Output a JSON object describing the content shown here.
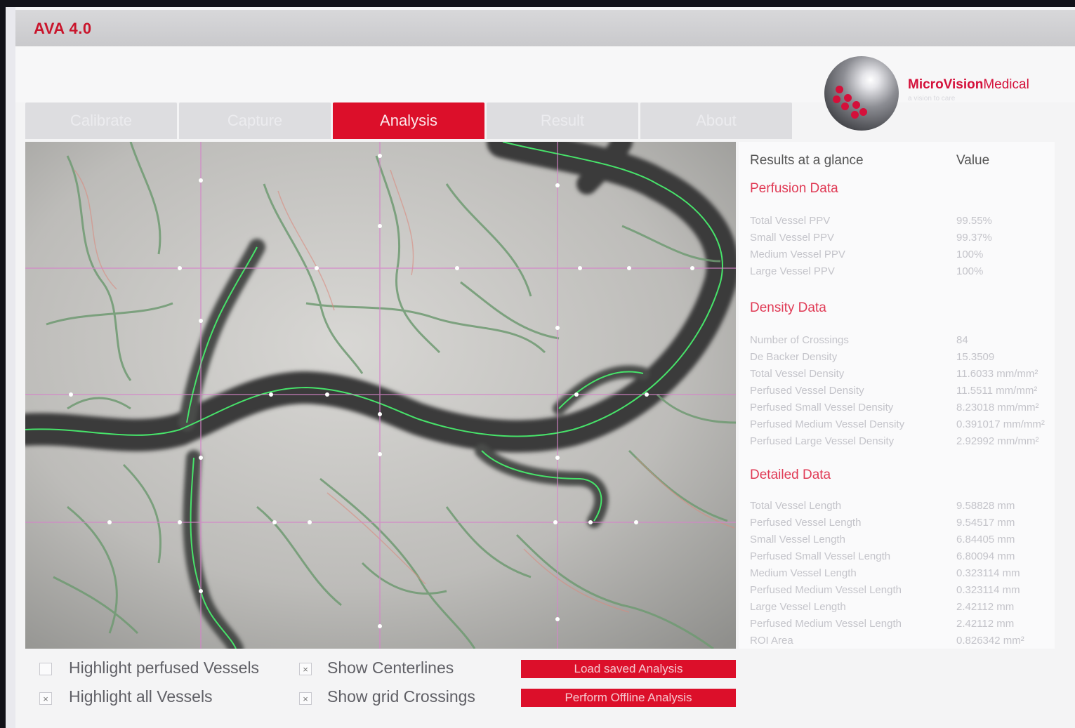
{
  "app": {
    "title": "AVA 4.0"
  },
  "brand": {
    "name_bold": "MicroVision",
    "name_light": "Medical",
    "tagline": "a vision to care"
  },
  "tabs": [
    {
      "label": "Calibrate",
      "active": false
    },
    {
      "label": "Capture",
      "active": false
    },
    {
      "label": "Analysis",
      "active": true
    },
    {
      "label": "Result",
      "active": false
    },
    {
      "label": "About",
      "active": false
    }
  ],
  "results": {
    "header_label": "Results at a glance",
    "header_value": "Value",
    "perfusion": {
      "title": "Perfusion Data",
      "rows": [
        {
          "label": "Total Vessel PPV",
          "value": "99.55%"
        },
        {
          "label": "Small Vessel PPV",
          "value": "99.37%"
        },
        {
          "label": "Medium Vessel PPV",
          "value": "100%"
        },
        {
          "label": "Large Vessel PPV",
          "value": "100%"
        }
      ]
    },
    "density": {
      "title": "Density Data",
      "rows": [
        {
          "label": "Number of Crossings",
          "value": "84"
        },
        {
          "label": "De Backer Density",
          "value": "15.3509"
        },
        {
          "label": "Total Vessel Density",
          "value": "11.6033 mm/mm²"
        },
        {
          "label": "Perfused Vessel Density",
          "value": "11.5511 mm/mm²"
        },
        {
          "label": "Perfused Small Vessel Density",
          "value": "8.23018 mm/mm²"
        },
        {
          "label": "Perfused Medium Vessel Density",
          "value": "0.391017 mm/mm²"
        },
        {
          "label": "Perfused Large Vessel Density",
          "value": "2.92992 mm/mm²"
        }
      ]
    },
    "detailed": {
      "title": "Detailed Data",
      "rows": [
        {
          "label": "Total Vessel Length",
          "value": "9.58828 mm"
        },
        {
          "label": "Perfused Vessel Length",
          "value": "9.54517 mm"
        },
        {
          "label": "Small Vessel Length",
          "value": "6.84405 mm"
        },
        {
          "label": "Perfused Small Vessel Length",
          "value": "6.80094 mm"
        },
        {
          "label": "Medium Vessel Length",
          "value": "0.323114 mm"
        },
        {
          "label": "Perfused Medium Vessel Length",
          "value": "0.323114 mm"
        },
        {
          "label": "Large Vessel Length",
          "value": "2.42112 mm"
        },
        {
          "label": "Perfused Medium Vessel Length",
          "value": "2.42112 mm"
        },
        {
          "label": "ROI Area",
          "value": "0.826342 mm²"
        }
      ]
    }
  },
  "controls": {
    "highlight_perfused": {
      "label": "Highlight perfused Vessels",
      "checked": false
    },
    "highlight_all": {
      "label": "Highlight all Vessels",
      "checked": true
    },
    "show_centerlines": {
      "label": "Show Centerlines",
      "checked": true
    },
    "show_grid": {
      "label": "Show grid Crossings",
      "checked": true
    },
    "load_button": "Load saved Analysis",
    "offline_button": "Perform Offline Analysis",
    "check_mark": "×"
  }
}
